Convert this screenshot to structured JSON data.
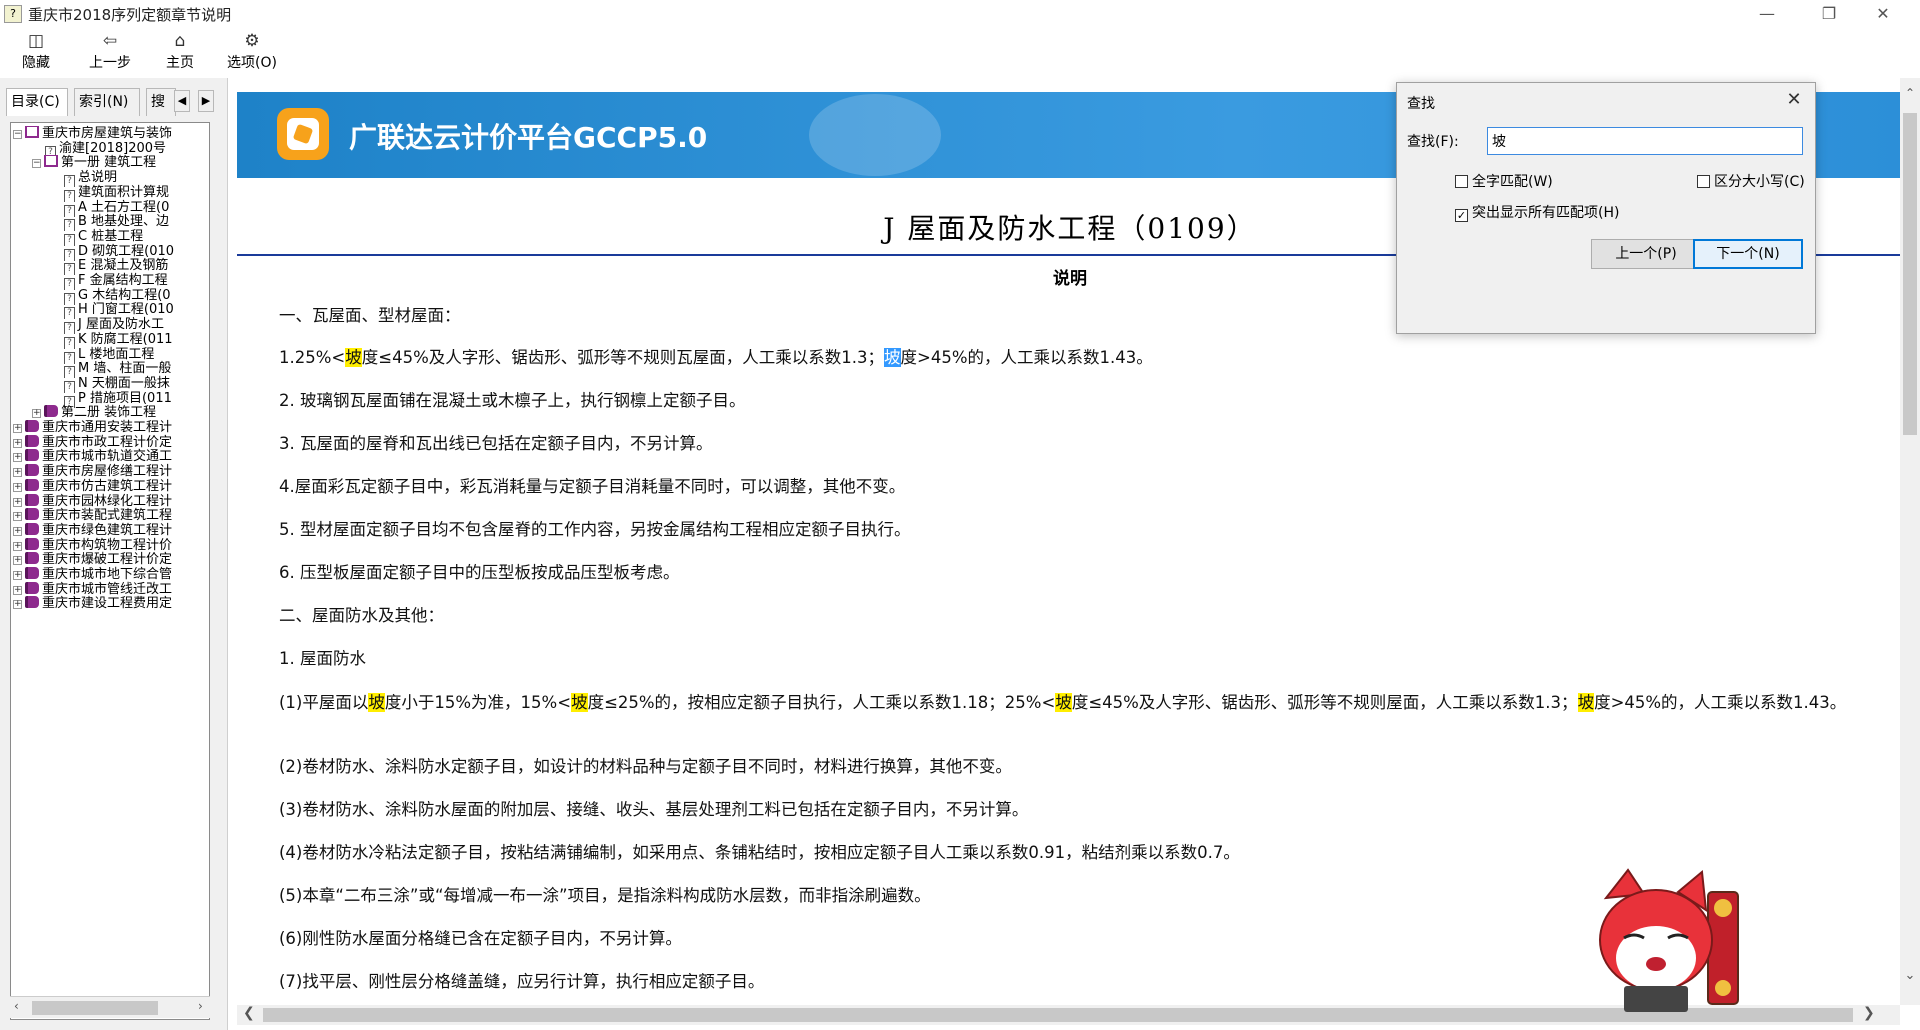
{
  "window": {
    "title": "重庆市2018序列定额章节说明",
    "minimize_icon": "minimize-icon",
    "restore_icon": "restore-icon",
    "close_icon": "close-icon"
  },
  "toolbar": {
    "hide_label": "隐藏",
    "back_label": "上一步",
    "home_label": "主页",
    "options_label": "选项(O)"
  },
  "left_tabs": {
    "contents": "目录(C)",
    "index": "索引(N)",
    "search": "搜"
  },
  "tree": [
    {
      "label": "重庆市房屋建筑与装饰",
      "level": 0,
      "kind": "book-open",
      "exp": "−"
    },
    {
      "label": "渝建[2018]200号",
      "level": 1,
      "kind": "page"
    },
    {
      "label": "第一册  建筑工程",
      "level": 1,
      "kind": "book-open",
      "exp": "−"
    },
    {
      "label": "总说明",
      "level": 2,
      "kind": "page"
    },
    {
      "label": "建筑面积计算规",
      "level": 2,
      "kind": "page"
    },
    {
      "label": "A  土石方工程(0",
      "level": 2,
      "kind": "page"
    },
    {
      "label": "B  地基处理、边",
      "level": 2,
      "kind": "page"
    },
    {
      "label": "C  桩基工程",
      "level": 2,
      "kind": "page"
    },
    {
      "label": "D  砌筑工程(010",
      "level": 2,
      "kind": "page"
    },
    {
      "label": "E  混凝土及钢筋",
      "level": 2,
      "kind": "page"
    },
    {
      "label": "F  金属结构工程",
      "level": 2,
      "kind": "page"
    },
    {
      "label": "G  木结构工程(0",
      "level": 2,
      "kind": "page"
    },
    {
      "label": "H  门窗工程(010",
      "level": 2,
      "kind": "page"
    },
    {
      "label": "J  屋面及防水工",
      "level": 2,
      "kind": "page"
    },
    {
      "label": "K  防腐工程(011",
      "level": 2,
      "kind": "page"
    },
    {
      "label": "L  楼地面工程",
      "level": 2,
      "kind": "page"
    },
    {
      "label": "M  墙、柱面一般",
      "level": 2,
      "kind": "page"
    },
    {
      "label": "N  天棚面一般抹",
      "level": 2,
      "kind": "page"
    },
    {
      "label": "P  措施项目(011",
      "level": 2,
      "kind": "page"
    },
    {
      "label": "第二册 装饰工程",
      "level": 1,
      "kind": "book-closed",
      "exp": "+"
    },
    {
      "label": "重庆市通用安装工程计",
      "level": 0,
      "kind": "book-closed",
      "exp": "+"
    },
    {
      "label": "重庆市市政工程计价定",
      "level": 0,
      "kind": "book-closed",
      "exp": "+"
    },
    {
      "label": "重庆市城市轨道交通工",
      "level": 0,
      "kind": "book-closed",
      "exp": "+"
    },
    {
      "label": "重庆市房屋修缮工程计",
      "level": 0,
      "kind": "book-closed",
      "exp": "+"
    },
    {
      "label": "重庆市仿古建筑工程计",
      "level": 0,
      "kind": "book-closed",
      "exp": "+"
    },
    {
      "label": "重庆市园林绿化工程计",
      "level": 0,
      "kind": "book-closed",
      "exp": "+"
    },
    {
      "label": "重庆市装配式建筑工程",
      "level": 0,
      "kind": "book-closed",
      "exp": "+"
    },
    {
      "label": "重庆市绿色建筑工程计",
      "level": 0,
      "kind": "book-closed",
      "exp": "+"
    },
    {
      "label": "重庆市构筑物工程计价",
      "level": 0,
      "kind": "book-closed",
      "exp": "+"
    },
    {
      "label": "重庆市爆破工程计价定",
      "level": 0,
      "kind": "book-closed",
      "exp": "+"
    },
    {
      "label": "重庆市城市地下综合管",
      "level": 0,
      "kind": "book-closed",
      "exp": "+"
    },
    {
      "label": "重庆市城市管线迁改工",
      "level": 0,
      "kind": "book-closed",
      "exp": "+"
    },
    {
      "label": "重庆市建设工程费用定",
      "level": 0,
      "kind": "book-closed",
      "exp": "+"
    }
  ],
  "banner": {
    "title": "广联达云计价平台GCCP5.0"
  },
  "document": {
    "heading": "J 屋面及防水工程（0109）",
    "subheading": "说明",
    "highlight_word": "坡",
    "paragraphs": [
      "一、瓦屋面、型材屋面：",
      "1.25%<坡度≤45%及人字形、锯齿形、弧形等不规则瓦屋面，人工乘以系数1.3；坡度>45%的，人工乘以系数1.43。",
      "2. 玻璃钢瓦屋面铺在混凝土或木檩子上，执行钢檩上定额子目。",
      "3. 瓦屋面的屋脊和瓦出线已包括在定额子目内，不另计算。",
      "4.屋面彩瓦定额子目中，彩瓦消耗量与定额子目消耗量不同时，可以调整，其他不变。",
      "5. 型材屋面定额子目均不包含屋脊的工作内容，另按金属结构工程相应定额子目执行。",
      "6. 压型板屋面定额子目中的压型板按成品压型板考虑。",
      "二、屋面防水及其他：",
      "1. 屋面防水",
      "(1)平屋面以坡度小于15%为准，15%<坡度≤25%的，按相应定额子目执行，人工乘以系数1.18；25%<坡度≤45%及人字形、锯齿形、弧形等不规则屋面，人工乘以系数1.3；坡度>45%的，人工乘以系数1.43。",
      "(2)卷材防水、涂料防水定额子目，如设计的材料品种与定额子目不同时，材料进行换算，其他不变。",
      "(3)卷材防水、涂料防水屋面的附加层、接缝、收头、基层处理剂工料已包括在定额子目内，不另计算。",
      "(4)卷材防水冷粘法定额子目，按粘结满铺编制，如采用点、条铺粘结时，按相应定额子目人工乘以系数0.91，粘结剂乘以系数0.7。",
      "(5)本章“二布三涂”或“每增减一布一涂”项目，是指涂料构成防水层数，而非指涂刷遍数。",
      "(6)刚性防水屋面分格缝已含在定额子目内，不另计算。",
      "(7)找平层、刚性层分格缝盖缝，应另行计算，执行相应定额子目。"
    ]
  },
  "find_dialog": {
    "title": "查找",
    "find_label": "查找(F):",
    "find_value": "坡",
    "whole_word": "全字匹配(W)",
    "match_case": "区分大小写(C)",
    "highlight_all": "突出显示所有匹配项(H)",
    "whole_word_checked": false,
    "match_case_checked": false,
    "highlight_all_checked": true,
    "prev_button": "上一个(P)",
    "next_button": "下一个(N)"
  },
  "colors": {
    "highlight": "#ffee00",
    "current_match": "#3399ff",
    "banner": "#2c8fd8",
    "heading_rule": "#1a3b9a"
  }
}
